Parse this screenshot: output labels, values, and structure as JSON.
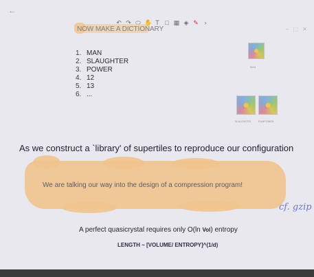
{
  "toolbar": {
    "back_glyph": "←",
    "tools": [
      {
        "name": "undo-icon",
        "glyph": "↶"
      },
      {
        "name": "redo-icon",
        "glyph": "↷"
      },
      {
        "name": "lasso-icon",
        "glyph": "⬭"
      },
      {
        "name": "hand-icon",
        "glyph": "✋"
      },
      {
        "name": "text-tool-icon",
        "glyph": "T"
      },
      {
        "name": "shape-icon",
        "glyph": "□"
      },
      {
        "name": "table-icon",
        "glyph": "▦"
      },
      {
        "name": "eraser-icon",
        "glyph": "◈"
      },
      {
        "name": "pen-icon",
        "glyph": "✎"
      },
      {
        "name": "more-icon",
        "glyph": "›"
      }
    ],
    "pen_color": "#c73535"
  },
  "window_controls": "– ⬚ ✕",
  "slide": {
    "title": "NOW MAKE A DICTIONARY",
    "list": [
      {
        "num": "1.",
        "text": "MAN"
      },
      {
        "num": "2.",
        "text": "SLAUGHTER"
      },
      {
        "num": "3.",
        "text": "POWER"
      },
      {
        "num": "4.",
        "text": "12"
      },
      {
        "num": "5.",
        "text": "13"
      },
      {
        "num": "6.",
        "text": "..."
      }
    ],
    "tiles": [
      {
        "caption": "MAN"
      },
      {
        "caption": "SLAUGHTER"
      },
      {
        "caption": "RAMPOWER"
      }
    ],
    "main_text": "As we construct a `library' of supertiles to reproduce our configuration",
    "highlight_text": "We are talking our way into the design of a compression program!",
    "handwriting": "cf. gzip",
    "bottom_text_pre": "A perfect quasicrystal requires only O(ln",
    "bottom_text_vol": "Vol",
    "bottom_text_post": ") entropy",
    "formula": "LENGTH ~ [VOLUME/ ENTROPY]^(1/d)"
  },
  "colors": {
    "background": "#e9e8ee",
    "highlighter": "#f0c38e",
    "handwriting_ink": "#6a78c8",
    "bezel": "#3b3b3b"
  }
}
